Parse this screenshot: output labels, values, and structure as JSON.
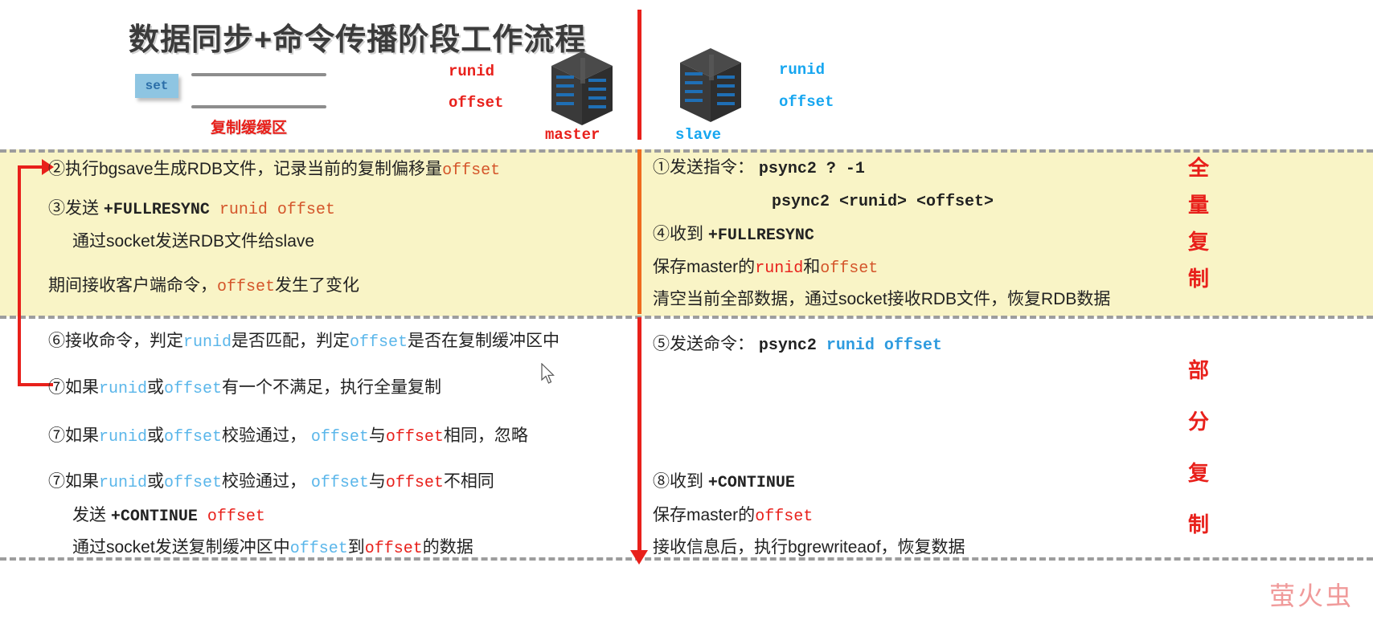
{
  "title": "数据同步+命令传播阶段工作流程",
  "header": {
    "set_chip": "set",
    "buffer_label": "复制缓缓区",
    "master": {
      "runid": "runid",
      "offset": "offset",
      "name": "master",
      "icon": "server-icon"
    },
    "slave": {
      "runid": "runid",
      "offset": "offset",
      "name": "slave",
      "icon": "server-icon"
    }
  },
  "full_sync": {
    "label_chars": [
      "全",
      "量",
      "复",
      "制"
    ],
    "master_lines": [
      {
        "parts": [
          {
            "t": "②执行bgsave生成RDB文件，记录当前的复制偏移量",
            "c": "dark",
            "m": false
          },
          {
            "t": "offset",
            "c": "orange",
            "m": true
          }
        ]
      },
      {
        "parts": [
          {
            "t": "③发送 ",
            "c": "dark",
            "m": false
          },
          {
            "t": "+FULLRESYNC ",
            "c": "dark",
            "m": true,
            "b": true
          },
          {
            "t": "runid offset",
            "c": "orange",
            "m": true
          }
        ]
      },
      {
        "parts": [
          {
            "t": "通过socket发送RDB文件给slave",
            "c": "dark",
            "m": false
          }
        ]
      },
      {
        "parts": [
          {
            "t": "期间接收客户端命令，",
            "c": "dark",
            "m": false
          },
          {
            "t": "offset",
            "c": "orange",
            "m": true
          },
          {
            "t": "发生了变化",
            "c": "dark",
            "m": false
          }
        ]
      }
    ],
    "slave_lines": [
      {
        "parts": [
          {
            "t": "①发送指令： ",
            "c": "dark",
            "m": false
          },
          {
            "t": "psync2  ? -1",
            "c": "dark",
            "m": true,
            "b": true
          }
        ]
      },
      {
        "parts": [
          {
            "t": "psync2  <runid> <offset>",
            "c": "dark",
            "m": true,
            "b": true
          }
        ]
      },
      {
        "parts": [
          {
            "t": "④收到 ",
            "c": "dark",
            "m": false
          },
          {
            "t": "+FULLRESYNC",
            "c": "dark",
            "m": true,
            "b": true
          }
        ]
      },
      {
        "parts": [
          {
            "t": "保存master的",
            "c": "dark",
            "m": false
          },
          {
            "t": "runid",
            "c": "red",
            "m": true
          },
          {
            "t": "和",
            "c": "dark",
            "m": false
          },
          {
            "t": "offset",
            "c": "orange",
            "m": true
          }
        ]
      },
      {
        "parts": [
          {
            "t": "清空当前全部数据，通过socket接收RDB文件，恢复RDB数据",
            "c": "dark",
            "m": false
          }
        ]
      }
    ]
  },
  "partial_sync": {
    "label_chars": [
      "部",
      "分",
      "复",
      "制"
    ],
    "master_lines": [
      {
        "parts": [
          {
            "t": "⑥接收命令，判定",
            "c": "dark",
            "m": false
          },
          {
            "t": "runid",
            "c": "ltblue",
            "m": true
          },
          {
            "t": "是否匹配，判定",
            "c": "dark",
            "m": false
          },
          {
            "t": "offset",
            "c": "ltblue",
            "m": true
          },
          {
            "t": "是否在复制缓冲区中",
            "c": "dark",
            "m": false
          }
        ]
      },
      {
        "parts": [
          {
            "t": "⑦如果",
            "c": "dark",
            "m": false
          },
          {
            "t": "runid",
            "c": "ltblue",
            "m": true
          },
          {
            "t": "或",
            "c": "dark",
            "m": false
          },
          {
            "t": "offset",
            "c": "ltblue",
            "m": true
          },
          {
            "t": "有一个不满足，执行全量复制",
            "c": "dark",
            "m": false
          }
        ]
      },
      {
        "parts": [
          {
            "t": "⑦如果",
            "c": "dark",
            "m": false
          },
          {
            "t": "runid",
            "c": "ltblue",
            "m": true
          },
          {
            "t": "或",
            "c": "dark",
            "m": false
          },
          {
            "t": "offset",
            "c": "ltblue",
            "m": true
          },
          {
            "t": "校验通过， ",
            "c": "dark",
            "m": false
          },
          {
            "t": "offset",
            "c": "ltblue",
            "m": true
          },
          {
            "t": "与",
            "c": "dark",
            "m": false
          },
          {
            "t": "offset",
            "c": "red",
            "m": true
          },
          {
            "t": "相同，忽略",
            "c": "dark",
            "m": false
          }
        ]
      },
      {
        "parts": [
          {
            "t": "⑦如果",
            "c": "dark",
            "m": false
          },
          {
            "t": "runid",
            "c": "ltblue",
            "m": true
          },
          {
            "t": "或",
            "c": "dark",
            "m": false
          },
          {
            "t": "offset",
            "c": "ltblue",
            "m": true
          },
          {
            "t": "校验通过， ",
            "c": "dark",
            "m": false
          },
          {
            "t": "offset",
            "c": "ltblue",
            "m": true
          },
          {
            "t": "与",
            "c": "dark",
            "m": false
          },
          {
            "t": "offset",
            "c": "red",
            "m": true
          },
          {
            "t": "不相同",
            "c": "dark",
            "m": false
          }
        ]
      },
      {
        "parts": [
          {
            "t": "发送 ",
            "c": "dark",
            "m": false
          },
          {
            "t": "+CONTINUE ",
            "c": "dark",
            "m": true,
            "b": true
          },
          {
            "t": "offset",
            "c": "red",
            "m": true
          }
        ]
      },
      {
        "parts": [
          {
            "t": "通过socket发送复制缓冲区中",
            "c": "dark",
            "m": false
          },
          {
            "t": "offset",
            "c": "ltblue",
            "m": true
          },
          {
            "t": "到",
            "c": "dark",
            "m": false
          },
          {
            "t": "offset",
            "c": "red",
            "m": true
          },
          {
            "t": "的数据",
            "c": "dark",
            "m": false
          }
        ]
      }
    ],
    "slave_lines": [
      {
        "parts": [
          {
            "t": "⑤发送命令： ",
            "c": "dark",
            "m": false
          },
          {
            "t": "psync2  ",
            "c": "dark",
            "m": true,
            "b": true
          },
          {
            "t": "runid offset",
            "c": "blue",
            "m": true,
            "b": true
          }
        ]
      },
      {
        "parts": [
          {
            "t": "⑧收到 ",
            "c": "dark",
            "m": false
          },
          {
            "t": "+CONTINUE",
            "c": "dark",
            "m": true,
            "b": true
          }
        ]
      },
      {
        "parts": [
          {
            "t": "保存master的",
            "c": "dark",
            "m": false
          },
          {
            "t": "offset",
            "c": "red",
            "m": true
          }
        ]
      },
      {
        "parts": [
          {
            "t": "接收信息后，执行bgrewriteaof，恢复数据",
            "c": "dark",
            "m": false
          }
        ]
      }
    ]
  },
  "watermark": "萤火虫",
  "colors": {
    "band_yellow": "#f9f4c6",
    "red": "#e8201b",
    "orange": "#d4552a",
    "blue": "#2e9bdf",
    "light_blue": "#5ab6ea",
    "divider_gray": "#9d9d9d"
  }
}
